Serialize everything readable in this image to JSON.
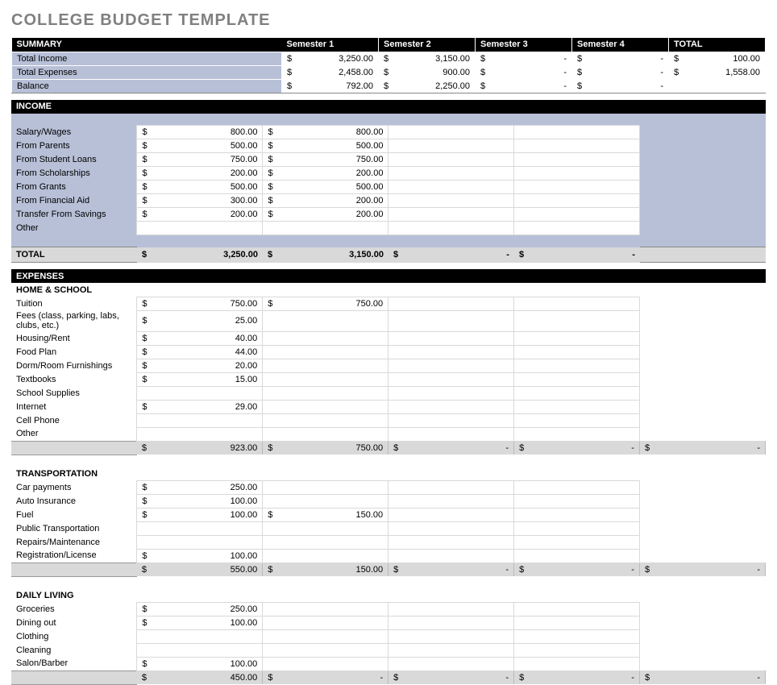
{
  "title": "COLLEGE BUDGET TEMPLATE",
  "cols": [
    "Semester 1",
    "Semester 2",
    "Semester 3",
    "Semester 4",
    "TOTAL"
  ],
  "summary": {
    "header": "SUMMARY",
    "rows": [
      {
        "label": "Total Income",
        "v": [
          "3,250.00",
          "3,150.00",
          "-",
          "-",
          "100.00"
        ]
      },
      {
        "label": "Total Expenses",
        "v": [
          "2,458.00",
          "900.00",
          "-",
          "-",
          "1,558.00"
        ]
      },
      {
        "label": "Balance",
        "v": [
          "792.00",
          "2,250.00",
          "-",
          "-",
          ""
        ]
      }
    ]
  },
  "income": {
    "header": "INCOME",
    "rows": [
      {
        "label": "Salary/Wages",
        "v": [
          "800.00",
          "800.00",
          "",
          ""
        ]
      },
      {
        "label": "From Parents",
        "v": [
          "500.00",
          "500.00",
          "",
          ""
        ]
      },
      {
        "label": "From Student Loans",
        "v": [
          "750.00",
          "750.00",
          "",
          ""
        ]
      },
      {
        "label": "From Scholarships",
        "v": [
          "200.00",
          "200.00",
          "",
          ""
        ]
      },
      {
        "label": "From Grants",
        "v": [
          "500.00",
          "500.00",
          "",
          ""
        ]
      },
      {
        "label": "From Financial Aid",
        "v": [
          "300.00",
          "200.00",
          "",
          ""
        ]
      },
      {
        "label": "Transfer From Savings",
        "v": [
          "200.00",
          "200.00",
          "",
          ""
        ]
      },
      {
        "label": "Other",
        "v": [
          "",
          "",
          "",
          ""
        ]
      }
    ],
    "total": {
      "label": "TOTAL",
      "v": [
        "3,250.00",
        "3,150.00",
        "-",
        "-"
      ]
    }
  },
  "expenses": {
    "header": "EXPENSES",
    "groups": [
      {
        "name": "HOME & SCHOOL",
        "rows": [
          {
            "label": "Tuition",
            "v": [
              "750.00",
              "750.00",
              "",
              ""
            ]
          },
          {
            "label": "Fees (class, parking, labs, clubs, etc.)",
            "v": [
              "25.00",
              "",
              "",
              ""
            ]
          },
          {
            "label": "Housing/Rent",
            "v": [
              "40.00",
              "",
              "",
              ""
            ]
          },
          {
            "label": "Food Plan",
            "v": [
              "44.00",
              "",
              "",
              ""
            ]
          },
          {
            "label": "Dorm/Room Furnishings",
            "v": [
              "20.00",
              "",
              "",
              ""
            ]
          },
          {
            "label": "Textbooks",
            "v": [
              "15.00",
              "",
              "",
              ""
            ]
          },
          {
            "label": "School Supplies",
            "v": [
              "",
              "",
              "",
              ""
            ]
          },
          {
            "label": "Internet",
            "v": [
              "29.00",
              "",
              "",
              ""
            ]
          },
          {
            "label": "Cell Phone",
            "v": [
              "",
              "",
              "",
              ""
            ]
          },
          {
            "label": "Other",
            "v": [
              "",
              "",
              "",
              ""
            ]
          }
        ],
        "subtotal": [
          "923.00",
          "750.00",
          "-",
          "-",
          "-"
        ]
      },
      {
        "name": "TRANSPORTATION",
        "rows": [
          {
            "label": "Car payments",
            "v": [
              "250.00",
              "",
              "",
              ""
            ]
          },
          {
            "label": "Auto Insurance",
            "v": [
              "100.00",
              "",
              "",
              ""
            ]
          },
          {
            "label": "Fuel",
            "v": [
              "100.00",
              "150.00",
              "",
              ""
            ]
          },
          {
            "label": "Public Transportation",
            "v": [
              "",
              "",
              "",
              ""
            ]
          },
          {
            "label": "Repairs/Maintenance",
            "v": [
              "",
              "",
              "",
              ""
            ]
          },
          {
            "label": "Registration/License",
            "v": [
              "100.00",
              "",
              "",
              ""
            ]
          }
        ],
        "subtotal": [
          "550.00",
          "150.00",
          "-",
          "-",
          "-"
        ]
      },
      {
        "name": "DAILY LIVING",
        "rows": [
          {
            "label": "Groceries",
            "v": [
              "250.00",
              "",
              "",
              ""
            ]
          },
          {
            "label": "Dining out",
            "v": [
              "100.00",
              "",
              "",
              ""
            ]
          },
          {
            "label": "Clothing",
            "v": [
              "",
              "",
              "",
              ""
            ]
          },
          {
            "label": "Cleaning",
            "v": [
              "",
              "",
              "",
              ""
            ]
          },
          {
            "label": "Salon/Barber",
            "v": [
              "100.00",
              "",
              "",
              ""
            ]
          }
        ],
        "subtotal": [
          "450.00",
          "-",
          "-",
          "-",
          "-"
        ]
      }
    ]
  }
}
